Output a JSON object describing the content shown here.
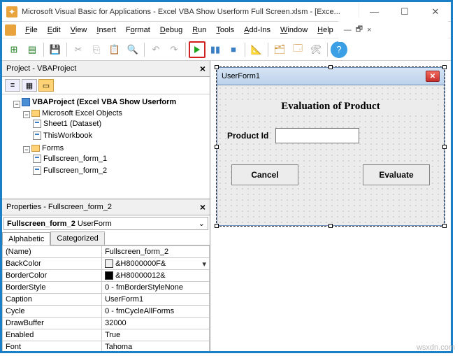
{
  "title": "Microsoft Visual Basic for Applications - Excel VBA Show Userform Full Screen.xlsm - [Exce...",
  "menu": {
    "file": "File",
    "edit": "Edit",
    "view": "View",
    "insert": "Insert",
    "format": "Format",
    "debug": "Debug",
    "run": "Run",
    "tools": "Tools",
    "addins": "Add-Ins",
    "window": "Window",
    "help": "Help"
  },
  "project": {
    "panel_title": "Project - VBAProject",
    "root": "VBAProject (Excel VBA Show Userform",
    "group1": "Microsoft Excel Objects",
    "sheet": "Sheet1 (Dataset)",
    "workbook": "ThisWorkbook",
    "group2": "Forms",
    "form1": "Fullscreen_form_1",
    "form2": "Fullscreen_form_2"
  },
  "properties": {
    "panel_title": "Properties - Fullscreen_form_2",
    "selector_name": "Fullscreen_form_2",
    "selector_type": "UserForm",
    "tab1": "Alphabetic",
    "tab2": "Categorized",
    "rows": [
      {
        "k": "(Name)",
        "v": "Fullscreen_form_2"
      },
      {
        "k": "BackColor",
        "v": "&H8000000F&",
        "swatch": "light",
        "dd": true
      },
      {
        "k": "BorderColor",
        "v": "&H80000012&",
        "swatch": "dark"
      },
      {
        "k": "BorderStyle",
        "v": "0 - fmBorderStyleNone"
      },
      {
        "k": "Caption",
        "v": "UserForm1"
      },
      {
        "k": "Cycle",
        "v": "0 - fmCycleAllForms"
      },
      {
        "k": "DrawBuffer",
        "v": "32000"
      },
      {
        "k": "Enabled",
        "v": "True"
      },
      {
        "k": "Font",
        "v": "Tahoma"
      }
    ]
  },
  "userform": {
    "caption": "UserForm1",
    "heading": "Evaluation of Product",
    "label": "Product Id",
    "btn_cancel": "Cancel",
    "btn_eval": "Evaluate"
  },
  "watermark": "wsxdn.com"
}
